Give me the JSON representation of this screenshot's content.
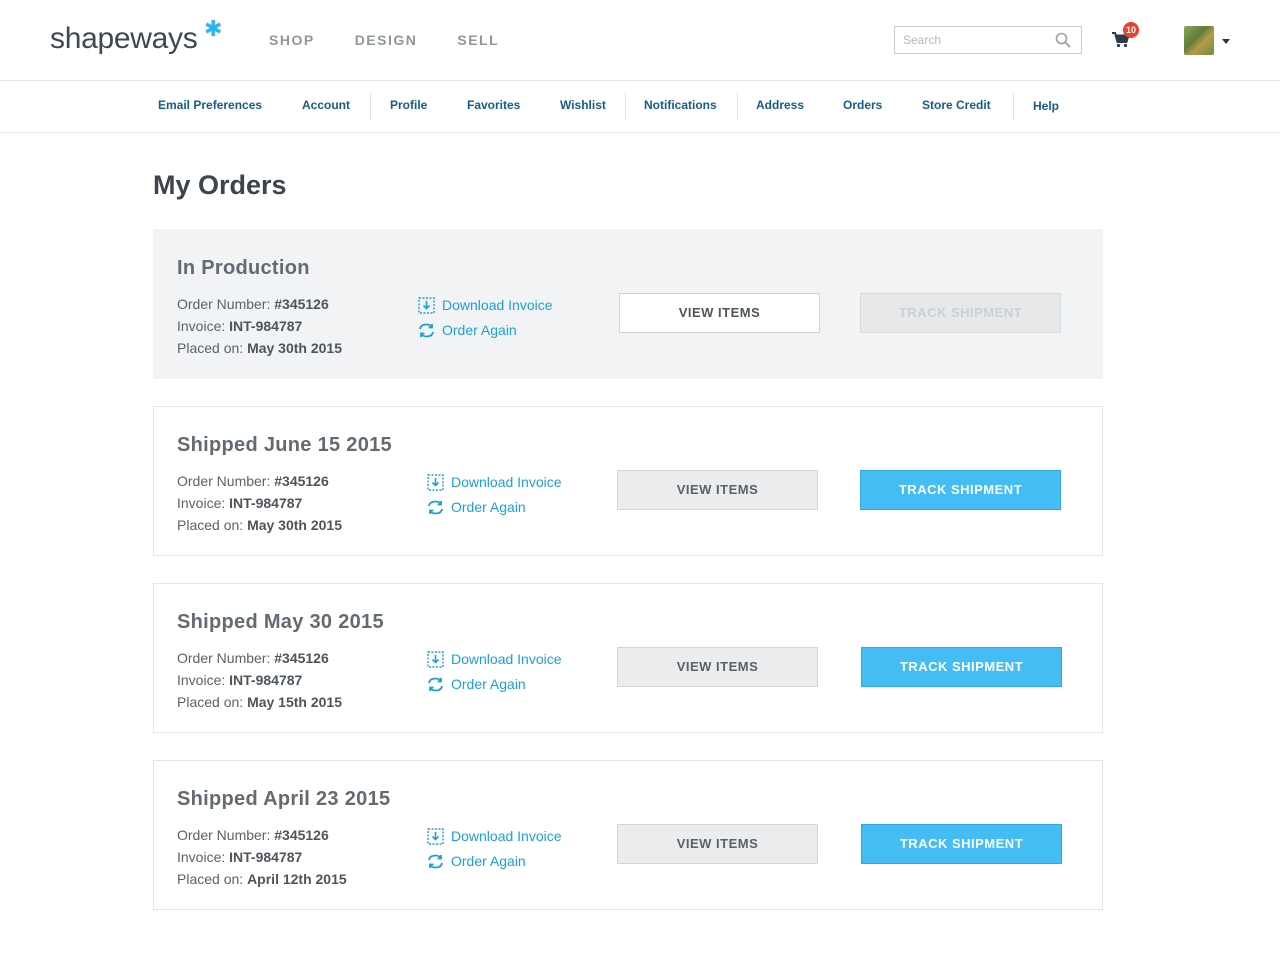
{
  "brand": {
    "name": "shapeways",
    "star": "✱"
  },
  "main_nav": [
    {
      "label": "SHOP"
    },
    {
      "label": "DESIGN"
    },
    {
      "label": "SELL"
    }
  ],
  "search": {
    "placeholder": "Search",
    "value": ""
  },
  "cart": {
    "count": "10"
  },
  "sub_nav": [
    {
      "label": "Email Preferences"
    },
    {
      "label": "Account"
    },
    {
      "label": "Profile"
    },
    {
      "label": "Favorites"
    },
    {
      "label": "Wishlist"
    },
    {
      "label": "Notifications"
    },
    {
      "label": "Address"
    },
    {
      "label": "Orders"
    },
    {
      "label": "Store Credit"
    },
    {
      "label": "Help"
    }
  ],
  "page": {
    "title": "My Orders"
  },
  "labels": {
    "order_number": "Order Number:",
    "invoice": "Invoice:",
    "placed_on": "Placed on:",
    "download_invoice": "Download Invoice",
    "order_again": "Order Again",
    "view_items": "VIEW ITEMS",
    "track_shipment": "TRACK SHIPMENT"
  },
  "orders": [
    {
      "status": "In Production",
      "order_number": "#345126",
      "invoice": "INT-984787",
      "placed_on": "May 30th 2015",
      "track_enabled": false
    },
    {
      "status": "Shipped June 15 2015",
      "order_number": "#345126",
      "invoice": "INT-984787",
      "placed_on": "May 30th 2015",
      "track_enabled": true
    },
    {
      "status": "Shipped May 30 2015",
      "order_number": "#345126",
      "invoice": "INT-984787",
      "placed_on": "May 15th 2015",
      "track_enabled": true
    },
    {
      "status": "Shipped April 23 2015",
      "order_number": "#345126",
      "invoice": "INT-984787",
      "placed_on": "April 12th 2015",
      "track_enabled": true
    }
  ],
  "colors": {
    "accent": "#43bdf4",
    "link": "#1d9fd8",
    "nav_link": "#165c8a",
    "badge": "#e8412c"
  }
}
